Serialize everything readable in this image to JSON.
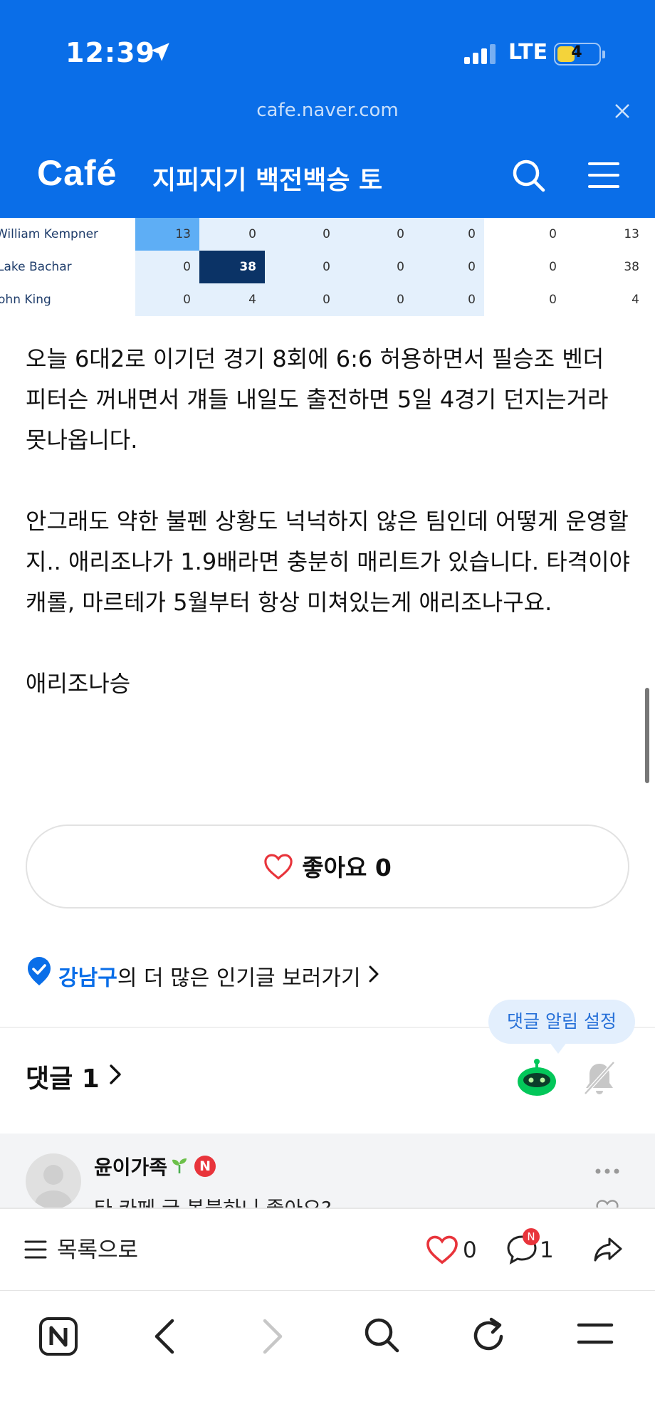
{
  "status_bar": {
    "time": "12:39",
    "network": "LTE",
    "battery": "4"
  },
  "url_bar": {
    "domain": "cafe.naver.com"
  },
  "cafe_header": {
    "logo": "Café",
    "title": "지피지기 백전백승 토"
  },
  "stats_table": {
    "rows": [
      {
        "name": "William Kempner",
        "cells": [
          "13",
          "0",
          "0",
          "0",
          "0",
          "0",
          "13"
        ]
      },
      {
        "name": "Lake Bachar",
        "cells": [
          "0",
          "38",
          "0",
          "0",
          "0",
          "0",
          "38"
        ]
      },
      {
        "name": "John King",
        "cells": [
          "0",
          "4",
          "0",
          "0",
          "0",
          "0",
          "4"
        ]
      }
    ]
  },
  "article": {
    "paragraphs": [
      "오늘 6대2로 이기던 경기 8회에 6:6 허용하면서 필승조 벤더 피터슨 꺼내면서 걔들 내일도 출전하면 5일 4경기 던지는거라 못나옵니다.",
      "안그래도 약한 불펜 상황도 넉넉하지 않은 팀인데 어떻게 운영할지.. 애리조나가 1.9배라면 충분히 매리트가 있습니다. 타격이야 캐롤, 마르테가 5월부터 항상 미쳐있는게 애리조나구요.",
      "애리조나승"
    ]
  },
  "like_button": {
    "label": "좋아요",
    "count": "0"
  },
  "popular_link": {
    "location": "강남구",
    "suffix": "의 더 많은 인기글 보러가기"
  },
  "comment_alert_tooltip": "댓글 알림 설정",
  "comments_header": {
    "label": "댓글",
    "count": "1"
  },
  "comment": {
    "author": "윤이가족",
    "badge": "N",
    "text": "타 카페 글 복붙하니 좋아요?"
  },
  "article_toolbar": {
    "list_label": "목록으로",
    "like_count": "0",
    "comment_count": "1",
    "comment_badge": "N"
  },
  "colors": {
    "brand_blue": "#0a6ee8",
    "like_red": "#e8343b",
    "robot_green": "#03c75a"
  },
  "icons": [
    "location-arrow-icon",
    "signal-icon",
    "close-icon",
    "search-icon",
    "menu-icon",
    "heart-icon",
    "verified-badge-icon",
    "chevron-right-icon",
    "robot-icon",
    "bell-off-icon",
    "sprout-icon",
    "more-icon",
    "list-icon",
    "comment-icon",
    "share-icon",
    "naver-home-icon",
    "back-icon",
    "forward-icon",
    "reload-icon"
  ]
}
